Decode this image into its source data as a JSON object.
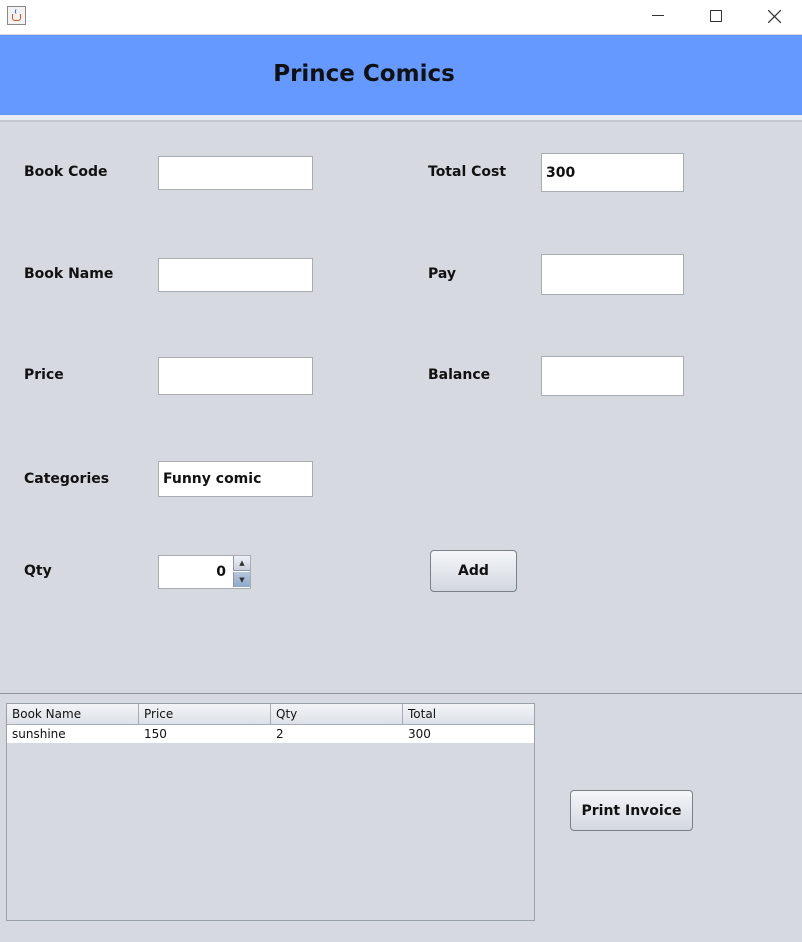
{
  "header": {
    "title": "Prince Comics"
  },
  "form": {
    "book_code": {
      "label": "Book Code",
      "value": ""
    },
    "book_name": {
      "label": "Book Name",
      "value": ""
    },
    "price": {
      "label": "Price",
      "value": ""
    },
    "categories": {
      "label": "Categories",
      "value": "Funny comic"
    },
    "qty": {
      "label": "Qty",
      "value": "0"
    },
    "total_cost": {
      "label": "Total Cost",
      "value": "300"
    },
    "pay": {
      "label": "Pay",
      "value": ""
    },
    "balance": {
      "label": "Balance",
      "value": ""
    }
  },
  "buttons": {
    "add": "Add",
    "print_invoice": "Print Invoice"
  },
  "table": {
    "columns": [
      "Book Name",
      "Price",
      "Qty",
      "Total"
    ],
    "rows": [
      [
        "sunshine",
        "150",
        "2",
        "300"
      ]
    ]
  },
  "icons": {
    "app": "java-cup-icon",
    "minimize": "minimize-icon",
    "maximize": "maximize-icon",
    "close": "close-icon"
  }
}
